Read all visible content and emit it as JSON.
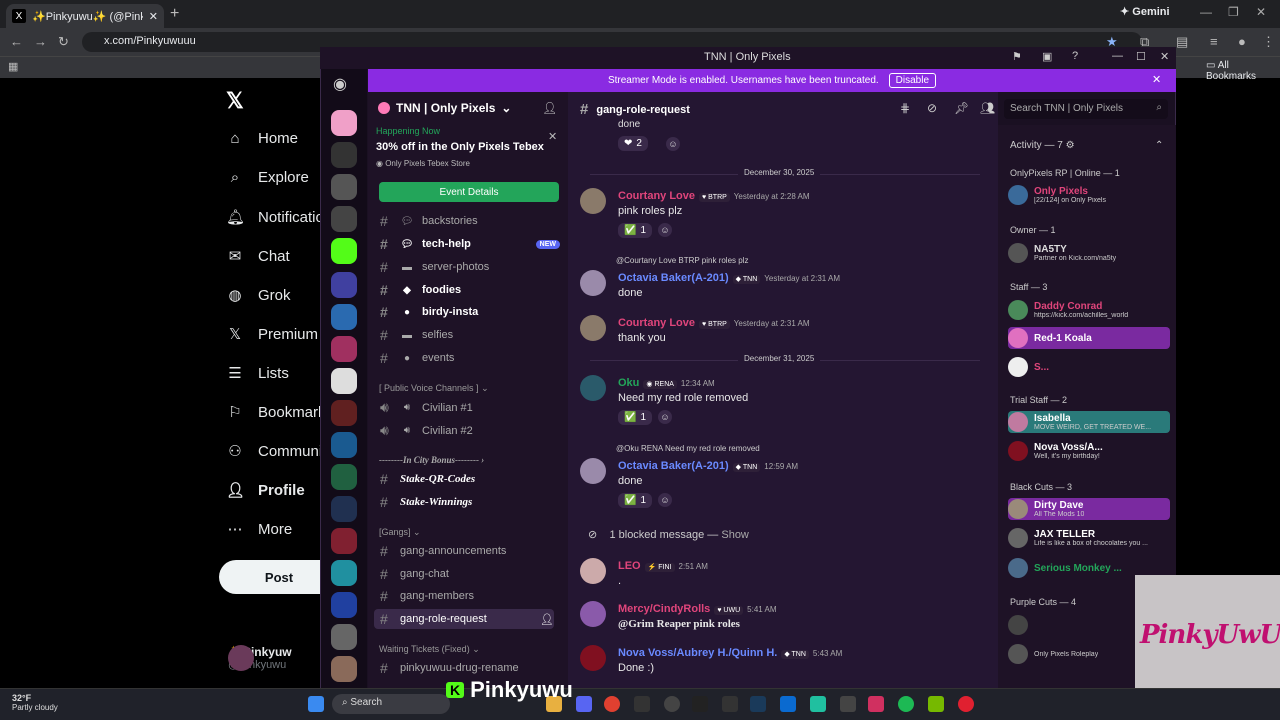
{
  "browser": {
    "tab_title": "✨Pinkyuwu✨ (@Pinkyuwuu...",
    "url": "x.com/Pinkyuwuuu",
    "gemini": "Gemini",
    "all_bookmarks": "All Bookmarks"
  },
  "x": {
    "nav": [
      "Home",
      "Explore",
      "Notifications",
      "Chat",
      "Grok",
      "Premium",
      "Lists",
      "Bookmarks",
      "Communities",
      "Profile",
      "More"
    ],
    "post": "Post",
    "profile_name": "✨Pinkyuw",
    "profile_handle": "@Pinkyuwu"
  },
  "discord": {
    "window_title": "TNN | Only Pixels",
    "streamer": "Streamer Mode is enabled. Usernames have been truncated.",
    "disable": "Disable",
    "server_name": "TNN | Only Pixels",
    "event": {
      "happening": "Happening Now",
      "title": "30% off in the Only Pixels Tebex",
      "store": "Only Pixels Tebex Store",
      "button": "Event Details"
    },
    "channels": [
      "backstories",
      "tech-help",
      "server-photos",
      "foodies",
      "birdy-insta",
      "selfies",
      "events"
    ],
    "new_badge": "NEW",
    "voice_cat": "[ Public Voice Channels ]",
    "voice": [
      "Civilian #1",
      "Civilian #2"
    ],
    "city_cat": "--------In City Bonus--------",
    "city": [
      "Stake-QR-Codes",
      "Stake-Winnings"
    ],
    "gang_cat": "[Gangs]",
    "gangs": [
      "gang-announcements",
      "gang-chat",
      "gang-members",
      "gang-role-request"
    ],
    "wait_cat": "Waiting Tickets (Fixed)",
    "wait": [
      "pinkyuwuu-drug-rename"
    ],
    "current_channel": "gang-role-request",
    "search": "Search TNN | Only Pixels",
    "top_text": "done",
    "top_react": "2",
    "dates": [
      "December 30, 2025",
      "December 31, 2025"
    ],
    "messages": [
      {
        "name": "Courtany Love",
        "tag": "BTRP",
        "time": "Yesterday at 2:28 AM",
        "text": "pink roles plz",
        "react": "1"
      },
      {
        "reply": "@Courtany Love  BTRP  pink roles plz",
        "name": "Octavia Baker(A-201)",
        "tag": "TNN",
        "time": "Yesterday at 2:31 AM",
        "text": "done"
      },
      {
        "name": "Courtany Love",
        "tag": "BTRP",
        "time": "Yesterday at 2:31 AM",
        "text": "thank you"
      },
      {
        "name": "Oku",
        "tag": "RENA",
        "time": "12:34 AM",
        "text": "Need my red role removed",
        "react": "1"
      },
      {
        "reply": "@Oku  RENA  Need my red role removed",
        "name": "Octavia Baker(A-201)",
        "tag": "TNN",
        "time": "12:59 AM",
        "text": "done",
        "react": "1"
      },
      {
        "name": "LEO",
        "tag": "FINI",
        "time": "2:51 AM",
        "text": "."
      },
      {
        "name": "Mercy/CindyRolls",
        "tag": "UWU",
        "time": "5:41 AM",
        "text": "@Grim Reaper  pink roles"
      },
      {
        "name": "Nova Voss/Aubrey H./Quinn H.",
        "tag": "TNN",
        "time": "5:43 AM",
        "text": "Done :)"
      }
    ],
    "blocked": "1 blocked message —",
    "show": "Show",
    "activity": "Activity — 7",
    "groups": [
      {
        "h": "OnlyPixels RP | Online — 1",
        "m": [
          {
            "n": "Only Pixels",
            "s": "[22/124] on Only Pixels",
            "c": "#e0457b"
          }
        ]
      },
      {
        "h": "Owner — 1",
        "m": [
          {
            "n": "NA5TY",
            "s": "Partner on Kick.com/na5ty",
            "c": "#ddd"
          }
        ]
      },
      {
        "h": "Staff — 3",
        "m": [
          {
            "n": "Daddy Conrad",
            "s": "https://kick.com/achilles_world",
            "c": "#e0457b"
          },
          {
            "n": "Red-1 Koala",
            "s": "",
            "c": "#fff"
          },
          {
            "n": "S...",
            "s": "",
            "c": "#e0457b"
          }
        ]
      },
      {
        "h": "Trial Staff — 2",
        "m": [
          {
            "n": "Isabella",
            "s": "MOVE WEIRD, GET TREATED WE...",
            "c": "#fff"
          },
          {
            "n": "Nova Voss/A...",
            "s": "Well, it's my birthday!",
            "c": "#fff"
          }
        ]
      },
      {
        "h": "Black Cuts — 3",
        "m": [
          {
            "n": "Dirty Dave",
            "s": "All The Mods 10",
            "c": "#fff"
          },
          {
            "n": "JAX TELLER",
            "s": "Life is like a box of chocolates you ...",
            "c": "#fff"
          },
          {
            "n": "Serious Monkey ...",
            "s": "",
            "c": "#23a55a"
          }
        ]
      },
      {
        "h": "Purple Cuts — 4",
        "m": [
          {
            "n": "",
            "s": "",
            "c": "#fff"
          },
          {
            "n": "",
            "s": "Only Pixels Roleplay",
            "c": "#fff"
          }
        ]
      }
    ]
  },
  "taskbar": {
    "temp": "32°F",
    "cond": "Partly cloudy",
    "search": "Search",
    "overlay": "Pinkyuwu"
  }
}
